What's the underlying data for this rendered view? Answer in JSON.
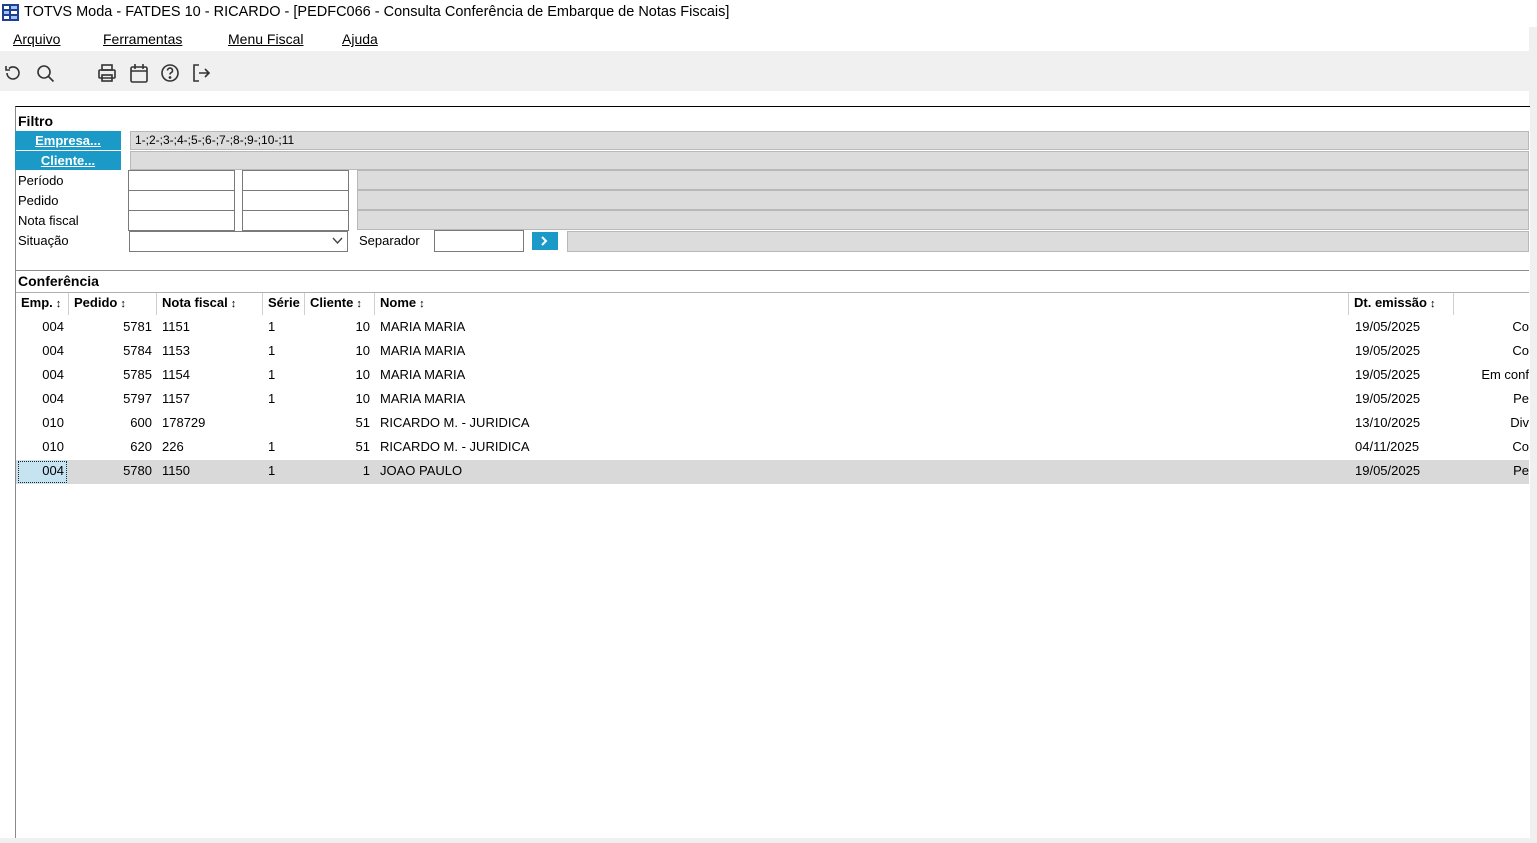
{
  "window": {
    "title": "TOTVS Moda - FATDES 10 - RICARDO - [PEDFC066 - Consulta Conferência de Embarque de Notas Fiscais]"
  },
  "menu": [
    {
      "label": "Arquivo"
    },
    {
      "label": "Ferramentas"
    },
    {
      "label": "Menu Fiscal"
    },
    {
      "label": "Ajuda"
    }
  ],
  "toolbar": {
    "icons": [
      "refresh-icon",
      "search-icon",
      "print-icon",
      "calendar-icon",
      "help-icon",
      "exit-icon"
    ]
  },
  "filtro": {
    "title": "Filtro",
    "empresa_button": "Empresa...",
    "empresa_value": "1-;2-;3-;4-;5-;6-;7-;8-;9-;10-;11",
    "cliente_button": "Cliente...",
    "cliente_value": "",
    "periodo_label": "Período",
    "pedido_label": "Pedido",
    "nota_fiscal_label": "Nota fiscal",
    "situacao_label": "Situação",
    "situacao_value": "",
    "separador_label": "Separador",
    "separador_value": ""
  },
  "conferencia": {
    "title": "Conferência",
    "columns": {
      "emp": "Emp.",
      "pedido": "Pedido",
      "nota_fiscal": "Nota fiscal",
      "serie": "Série",
      "cliente": "Cliente",
      "nome": "Nome",
      "dt_emissao": "Dt. emissão"
    },
    "rows": [
      {
        "emp": "004",
        "pedido": "5781",
        "nf": "1151",
        "serie": "1",
        "cliente": "10",
        "nome": "MARIA MARIA",
        "dt": "19/05/2025",
        "sit": "Co"
      },
      {
        "emp": "004",
        "pedido": "5784",
        "nf": "1153",
        "serie": "1",
        "cliente": "10",
        "nome": "MARIA MARIA",
        "dt": "19/05/2025",
        "sit": "Co"
      },
      {
        "emp": "004",
        "pedido": "5785",
        "nf": "1154",
        "serie": "1",
        "cliente": "10",
        "nome": "MARIA MARIA",
        "dt": "19/05/2025",
        "sit": "Em conf"
      },
      {
        "emp": "004",
        "pedido": "5797",
        "nf": "1157",
        "serie": "1",
        "cliente": "10",
        "nome": "MARIA MARIA",
        "dt": "19/05/2025",
        "sit": "Pe"
      },
      {
        "emp": "010",
        "pedido": "600",
        "nf": "178729",
        "serie": "",
        "cliente": "51",
        "nome": "RICARDO M. - JURIDICA",
        "dt": "13/10/2025",
        "sit": "Div"
      },
      {
        "emp": "010",
        "pedido": "620",
        "nf": "226",
        "serie": "1",
        "cliente": "51",
        "nome": "RICARDO M. - JURIDICA",
        "dt": "04/11/2025",
        "sit": "Co"
      },
      {
        "emp": "004",
        "pedido": "5780",
        "nf": "1150",
        "serie": "1",
        "cliente": "1",
        "nome": "JOAO PAULO",
        "dt": "19/05/2025",
        "sit": "Pe"
      }
    ]
  },
  "colors": {
    "accent": "#1b9ac7",
    "field_gray": "#dcdcdc",
    "selected_row": "#d9d9d9",
    "toolbar_bg": "#f0f0f0"
  }
}
